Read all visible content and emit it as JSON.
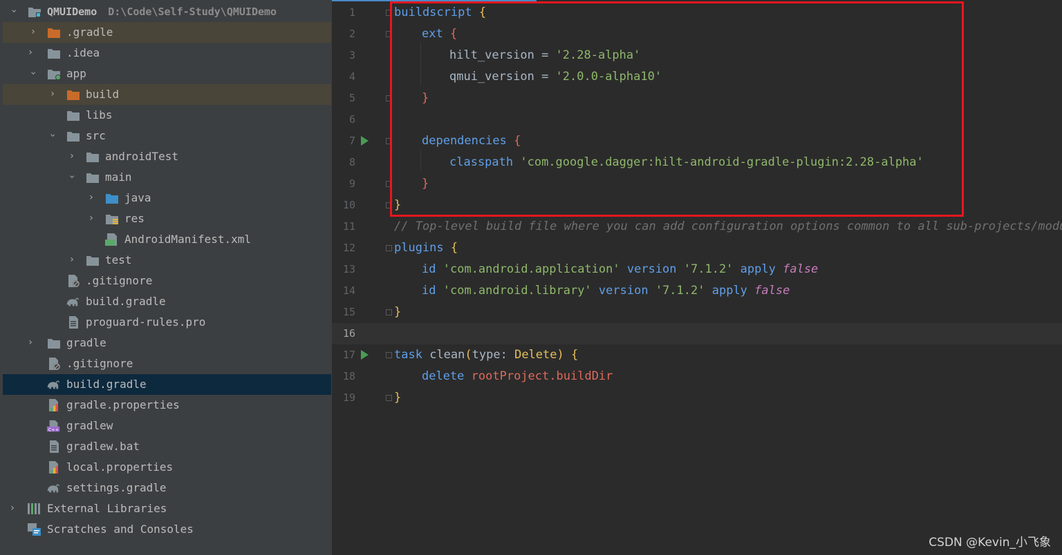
{
  "project_tree": {
    "root": {
      "name": "QMUIDemo",
      "path": "D:\\Code\\Self-Study\\QMUIDemo"
    },
    "items": [
      {
        "label": ".gradle"
      },
      {
        "label": ".idea"
      },
      {
        "label": "app"
      },
      {
        "label": "build"
      },
      {
        "label": "libs"
      },
      {
        "label": "src"
      },
      {
        "label": "androidTest"
      },
      {
        "label": "main"
      },
      {
        "label": "java"
      },
      {
        "label": "res"
      },
      {
        "label": "AndroidManifest.xml",
        "badge": "MF"
      },
      {
        "label": "test"
      },
      {
        "label": ".gitignore"
      },
      {
        "label": "build.gradle"
      },
      {
        "label": "proguard-rules.pro"
      },
      {
        "label": "gradle"
      },
      {
        "label": ".gitignore"
      },
      {
        "label": "build.gradle"
      },
      {
        "label": "gradle.properties"
      },
      {
        "label": "gradlew",
        "badge": "C++"
      },
      {
        "label": "gradlew.bat"
      },
      {
        "label": "local.properties"
      },
      {
        "label": "settings.gradle"
      },
      {
        "label": "External Libraries"
      },
      {
        "label": "Scratches and Consoles"
      }
    ]
  },
  "editor": {
    "line_numbers": [
      "1",
      "2",
      "3",
      "4",
      "5",
      "6",
      "7",
      "8",
      "9",
      "10",
      "11",
      "12",
      "13",
      "14",
      "15",
      "16",
      "17",
      "18",
      "19"
    ],
    "current_line": "16",
    "lines": [
      {
        "t": [
          "buildscript",
          " ",
          "{"
        ]
      },
      {
        "t": [
          "ext",
          " ",
          "{"
        ]
      },
      {
        "t": [
          "hilt_version",
          " = ",
          "'2.28-alpha'"
        ]
      },
      {
        "t": [
          "qmui_version",
          " = ",
          "'2.0.0-alpha10'"
        ]
      },
      {
        "t": [
          "}"
        ]
      },
      {
        "t": []
      },
      {
        "t": [
          "dependencies",
          " ",
          "{"
        ]
      },
      {
        "t": [
          "classpath",
          " ",
          "'com.google.dagger:hilt-android-gradle-plugin:2.28-alpha'"
        ]
      },
      {
        "t": [
          "}"
        ]
      },
      {
        "t": [
          "}"
        ]
      },
      {
        "t": [
          "// Top-level build file where you can add configuration options common to all sub-projects/modules."
        ]
      },
      {
        "t": [
          "plugins",
          " ",
          "{"
        ]
      },
      {
        "t": [
          "id",
          " ",
          "'com.android.application'",
          " ",
          "version",
          " ",
          "'7.1.2'",
          " ",
          "apply",
          " ",
          "false"
        ]
      },
      {
        "t": [
          "id",
          " ",
          "'com.android.library'",
          " ",
          "version",
          " ",
          "'7.1.2'",
          " ",
          "apply",
          " ",
          "false"
        ]
      },
      {
        "t": [
          "}"
        ]
      },
      {
        "t": []
      },
      {
        "t": [
          "task",
          " ",
          "clean",
          "(",
          "type",
          ": ",
          "Delete",
          ") ",
          "{"
        ]
      },
      {
        "t": [
          "delete",
          " ",
          "rootProject",
          ".",
          "buildDir"
        ]
      },
      {
        "t": [
          "}"
        ]
      }
    ]
  },
  "watermark": "CSDN @Kevin_小飞象",
  "colors": {
    "tree_bg": "#3c3f41",
    "editor_bg": "#2b2b2b",
    "selection": "#0d293e",
    "highlight_box": "#e8161e",
    "keyword_blue": "#5f9fe8",
    "string_green": "#8fb86b"
  }
}
